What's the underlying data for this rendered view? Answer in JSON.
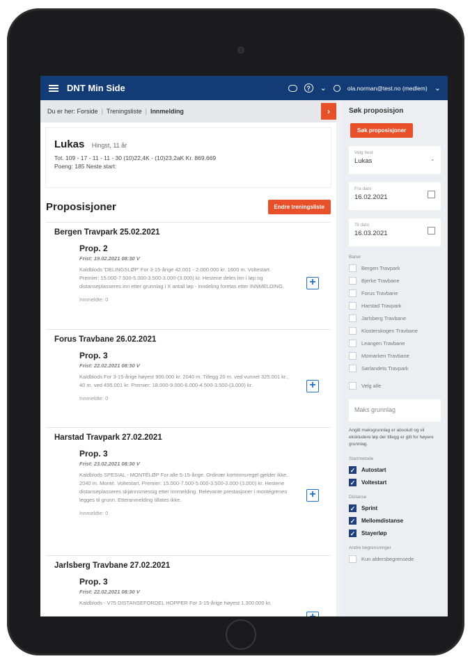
{
  "topbar": {
    "title": "DNT Min Side",
    "help_chevron": "?",
    "user_email": "ola.norman@test.no (medlem)"
  },
  "breadcrumb": {
    "prefix": "Du er her:",
    "items": [
      "Forside",
      "Treningsliste",
      "Innmelding"
    ],
    "toggle": "›"
  },
  "horse": {
    "name": "Lukas",
    "meta": "Hingst, 11 år",
    "stats": "Tot. 109 - 17 - 11 - 11 - 30 (10)22,4K - (10)23,2aK Kr. 869.669",
    "points": "Poeng: 185 Neste start:"
  },
  "propositions": {
    "title": "Proposisjoner",
    "button": "Endre treningsliste",
    "races": [
      {
        "title": "Bergen Travpark 25.02.2021",
        "prop": "Prop. 2",
        "frist": "Frist: 19.02.2021 08:30 V",
        "desc": "Kaldblods 'DELINGSLØP' For 3-15-årige 42.001 - 2.000.000 kr. 1600 m. Voltestart. Premier: 15.000-7.500-5.000-3.500-3.000-(3.000) kr. Hestene deles inn i løp og distanseplasseres inn etter grunnlag i X antall løp - inndeling foretas etter INNMELDING.",
        "innmeldte": "Innmeldte: 0"
      },
      {
        "title": "Forus Travbane 26.02.2021",
        "prop": "Prop. 3",
        "frist": "Frist: 22.02.2021 08:30 V",
        "desc": "Kaldblods For 3-15-årige høyest 900.000 kr. 2040 m. Tillegg 20 m. ved vunnet 325.001 kr., 40 m. ved 495.001 kr. Premier: 18.000-9.000-6.000-4.500-3.500-(3.000) kr.",
        "innmeldte": "Innmeldte: 0"
      },
      {
        "title": "Harstad Travpark 27.02.2021",
        "prop": "Prop. 3",
        "frist": "Frist: 23.02.2021 08:30 V",
        "desc": "Kaldblods SPESIAL - MONTÉLØP For alle 5-15-årige. Ordinær kortrinnsregel gjelder ikke. 2040 m. Monté. Voltestart. Premier: 15.000-7.500-5.000-3.500-3.000-(3.000) kr. Hestene distanseplasseres skjønnsmessig etter innmelding. Relevante prestasjoner i montégrenen legges til grunn. Etteranmelding tillates ikke.",
        "innmeldte": "Innmeldte: 0"
      },
      {
        "title": "Jarlsberg Travbane 27.02.2021",
        "prop": "Prop. 3",
        "frist": "Frist: 22.02.2021 08:30 V",
        "desc": "Kaldblods - V75 DISTANSEFORDEL HOPPER For 3-15-årige høyest 1.300.000 kr.",
        "innmeldte": ""
      }
    ]
  },
  "sidebar": {
    "title": "Søk proposisjon",
    "search_button": "Søk proposisjoner",
    "horse_select": {
      "label": "Velg hest",
      "value": "Lukas"
    },
    "from_date": {
      "label": "Fra dato",
      "value": "16.02.2021"
    },
    "to_date": {
      "label": "Til dato",
      "value": "16.03.2021"
    },
    "tracks_label": "Baner",
    "tracks": [
      "Bergen Travpark",
      "Bjerke Travbane",
      "Forus Travbane",
      "Harstad Travpark",
      "Jarlsberg Travbane",
      "Klosterskogen Travbane",
      "Leangen Travbane",
      "Momarken Travbane",
      "Sørlandets Travpark"
    ],
    "select_all": "Velg alle",
    "max_placeholder": "Maks grunnlag",
    "max_note": "Angitt maksgrunnlag er absolutt og vil ekskludere løp der tillegg er gitt for høyere grunnlag.",
    "start_label": "Startmetode",
    "start_methods": [
      "Autostart",
      "Voltestart"
    ],
    "distance_label": "Distanse",
    "distances": [
      "Sprint",
      "Mellomdistanse",
      "Stayerløp"
    ],
    "other_label": "Andre begrensninger",
    "other": [
      "Kun aldersbegrensede"
    ],
    "colors": {
      "navy": "#133b76",
      "orange": "#e8502a",
      "blue": "#1f6fc9"
    }
  }
}
